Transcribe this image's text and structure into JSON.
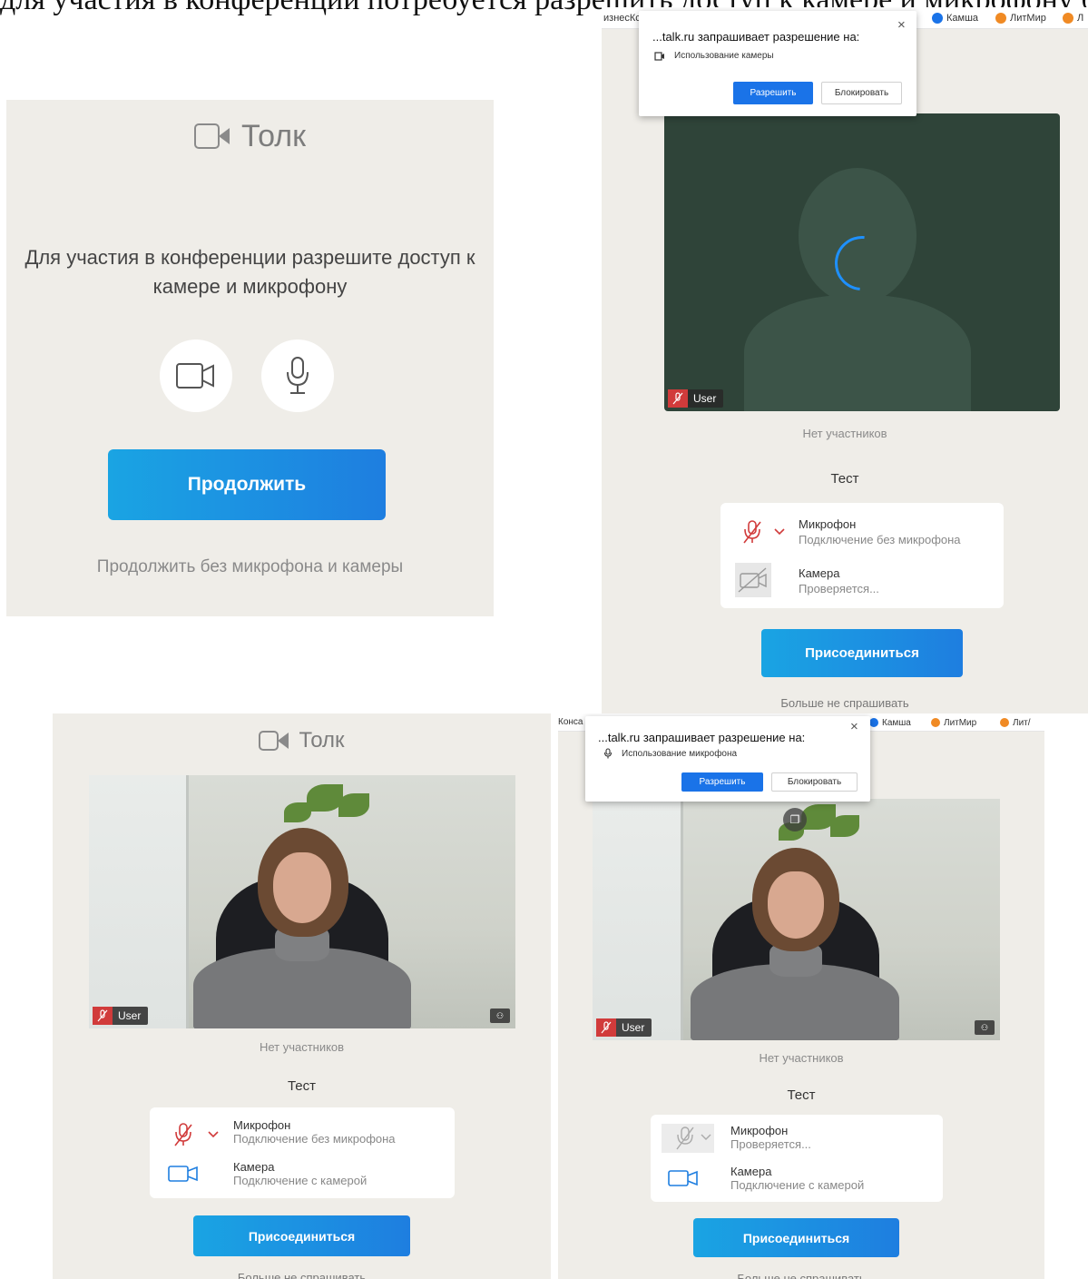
{
  "top_caption": "для участия в конференции потребуется разрешить доступ к камере и микрофону браузера",
  "panel_a": {
    "logo_text": "Толк",
    "message": "Для участия в конференции разрешите доступ к камере и микрофону",
    "continue_label": "Продолжить",
    "continue_without_label": "Продолжить без микрофона и камеры"
  },
  "panel_b": {
    "bookmarks_left": "изнесКс",
    "bookmarks": [
      {
        "label": "Камша",
        "color": "#1a73e8"
      },
      {
        "label": "ЛитМир",
        "color": "#f08a24"
      },
      {
        "label": "Л",
        "color": "#f08a24"
      }
    ],
    "popup": {
      "title": "...talk.ru запрашивает разрешение на:",
      "item_icon": "camera-icon",
      "item": "Использование камеры",
      "allow": "Разрешить",
      "block": "Блокировать"
    },
    "user_name": "User",
    "no_participants": "Нет участников",
    "test_title": "Тест",
    "mic_title": "Микрофон",
    "mic_status": "Подключение без микрофона",
    "cam_title": "Камера",
    "cam_status": "Проверяется...",
    "join_label": "Присоединиться",
    "dont_ask": "Больше не спрашивать"
  },
  "panel_c": {
    "logo_text": "Толк",
    "user_name": "User",
    "no_participants": "Нет участников",
    "test_title": "Тест",
    "mic_title": "Микрофон",
    "mic_status": "Подключение без микрофона",
    "cam_title": "Камера",
    "cam_status": "Подключение с камерой",
    "join_label": "Присоединиться",
    "dont_ask": "Больше не спрашивать"
  },
  "panel_d": {
    "bookmarks_left": "Конса",
    "bookmarks": [
      {
        "label": "Камша",
        "color": "#1a73e8"
      },
      {
        "label": "ЛитМир",
        "color": "#f08a24"
      },
      {
        "label": "Лит/",
        "color": "#f08a24"
      }
    ],
    "popup": {
      "title": "...talk.ru запрашивает разрешение на:",
      "item_icon": "microphone-icon",
      "item": "Использование микрофона",
      "allow": "Разрешить",
      "block": "Блокировать"
    },
    "user_name": "User",
    "no_participants": "Нет участников",
    "test_title": "Тест",
    "mic_title": "Микрофон",
    "mic_status": "Проверяется...",
    "cam_title": "Камера",
    "cam_status": "Подключение с камерой",
    "join_label": "Присоединиться",
    "dont_ask": "Больше не спрашивать"
  },
  "colors": {
    "panel_bg": "#efede8",
    "primary": "#1e8fe2",
    "mic_muted": "#d13b3b",
    "camera_icon": "#1e7ee0",
    "video_placeholder": "#2f4439"
  }
}
